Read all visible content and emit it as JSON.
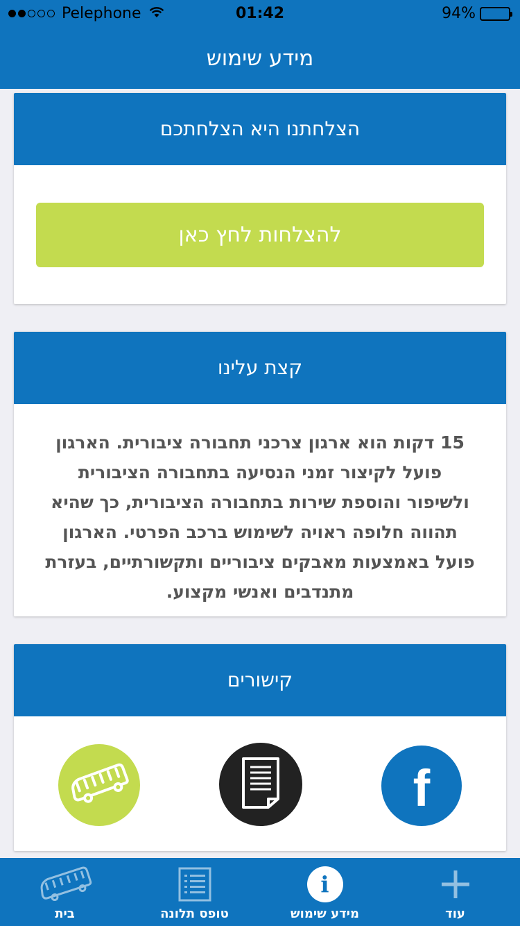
{
  "status_bar": {
    "carrier": "Pelephone",
    "time": "01:42",
    "battery": "94%",
    "battery_level": 0.94,
    "signal_bars_filled": 2,
    "signal_bars_total": 5
  },
  "header": {
    "title": "מידע שימוש"
  },
  "success_card": {
    "title": "הצלחתנו היא הצלחתכם",
    "button_label": "להצלחות לחץ כאן"
  },
  "about_card": {
    "title": "קצת עלינו",
    "body": "15 דקות הוא ארגון צרכני תחבורה ציבורית. הארגון פועל לקיצור זמני הנסיעה בתחבורה הציבורית ולשיפור והוספת שירות בתחבורה הציבורית, כך שהיא תהווה חלופה ראויה לשימוש ברכב הפרטי. הארגון פועל באמצעות מאבקים ציבוריים ותקשורתיים, בעזרת מתנדבים ואנשי מקצוע."
  },
  "links_card": {
    "title": "קישורים",
    "items": [
      {
        "icon": "bus-icon",
        "color": "#c3db4f"
      },
      {
        "icon": "document-icon",
        "color": "#222222"
      },
      {
        "icon": "facebook-icon",
        "color": "#0f74be"
      }
    ]
  },
  "tab_bar": {
    "tabs": [
      {
        "label": "בית",
        "icon": "bus-icon"
      },
      {
        "label": "טופס תלונה",
        "icon": "list-icon"
      },
      {
        "label": "מידע שימוש",
        "icon": "info-icon",
        "active": true
      },
      {
        "label": "עוד",
        "icon": "plus-icon"
      }
    ]
  },
  "colors": {
    "primary": "#0f74be",
    "accent": "#c3db4f",
    "background": "#efeff4"
  }
}
